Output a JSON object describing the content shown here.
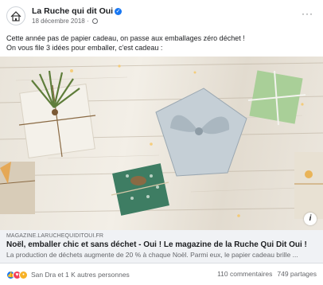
{
  "header": {
    "page_name": "La Ruche qui dit Oui",
    "date": "18 décembre 2018 · ",
    "more_label": "···"
  },
  "post": {
    "lines": [
      "Cette année pas de papier cadeau, on passe aux emballages zéro déchet !",
      "On vous file 3 idées pour emballer, c'est cadeau :"
    ]
  },
  "photo": {
    "info_label": "i"
  },
  "link": {
    "domain": "MAGAZINE.LARUCHEQUIDITOUI.FR",
    "title": "Noël, emballer chic et sans déchet - Oui ! Le magazine de la Ruche Qui Dit Oui !",
    "description": "La production de déchets augmente de 20 % à chaque Noël. Parmi eux, le papier cadeau brille ..."
  },
  "footer": {
    "reactions_text": "San Dra et 1 K autres personnes",
    "comments": "110 commentaires",
    "shares": "749 partages"
  },
  "colors": {
    "accent": "#1877f2",
    "link_bg": "#f0f2f5",
    "muted_text": "#65676b"
  },
  "icons": [
    "home-logo-icon",
    "verified-badge-icon",
    "globe-icon",
    "more-options-icon",
    "info-icon",
    "like-reaction-icon",
    "love-reaction-icon",
    "wow-reaction-icon"
  ]
}
